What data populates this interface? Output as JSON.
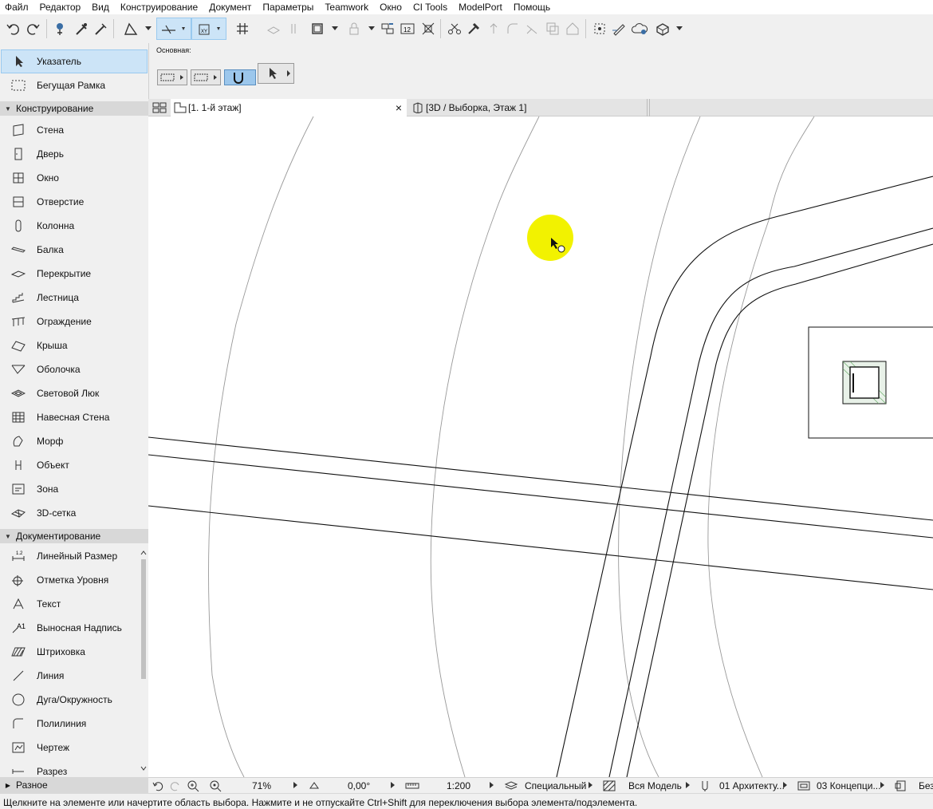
{
  "menu": [
    "Файл",
    "Редактор",
    "Вид",
    "Конструирование",
    "Документ",
    "Параметры",
    "Teamwork",
    "Окно",
    "CI Tools",
    "ModelPort",
    "Помощь"
  ],
  "toolbox": {
    "pointer": "Указатель",
    "marquee": "Бегущая Рамка",
    "group_design": "Конструирование",
    "design_tools": [
      {
        "label": "Стена",
        "icon": "wall-icon"
      },
      {
        "label": "Дверь",
        "icon": "door-icon"
      },
      {
        "label": "Окно",
        "icon": "window-icon"
      },
      {
        "label": "Отверстие",
        "icon": "opening-icon"
      },
      {
        "label": "Колонна",
        "icon": "column-icon"
      },
      {
        "label": "Балка",
        "icon": "beam-icon"
      },
      {
        "label": "Перекрытие",
        "icon": "slab-icon"
      },
      {
        "label": "Лестница",
        "icon": "stair-icon"
      },
      {
        "label": "Ограждение",
        "icon": "railing-icon"
      },
      {
        "label": "Крыша",
        "icon": "roof-icon"
      },
      {
        "label": "Оболочка",
        "icon": "shell-icon"
      },
      {
        "label": "Световой Люк",
        "icon": "skylight-icon"
      },
      {
        "label": "Навесная Стена",
        "icon": "curtain-wall-icon"
      },
      {
        "label": "Морф",
        "icon": "morph-icon"
      },
      {
        "label": "Объект",
        "icon": "object-icon"
      },
      {
        "label": "Зона",
        "icon": "zone-icon"
      },
      {
        "label": "3D-сетка",
        "icon": "mesh-icon"
      }
    ],
    "group_doc": "Документирование",
    "doc_tools": [
      {
        "label": "Линейный Размер",
        "icon": "dimension-icon"
      },
      {
        "label": "Отметка Уровня",
        "icon": "level-dimension-icon"
      },
      {
        "label": "Текст",
        "icon": "text-icon"
      },
      {
        "label": "Выносная Надпись",
        "icon": "label-icon"
      },
      {
        "label": "Штриховка",
        "icon": "fill-icon"
      },
      {
        "label": "Линия",
        "icon": "line-icon"
      },
      {
        "label": "Дуга/Окружность",
        "icon": "arc-icon"
      },
      {
        "label": "Полилиния",
        "icon": "polyline-icon"
      },
      {
        "label": "Чертеж",
        "icon": "drawing-icon"
      },
      {
        "label": "Разрез",
        "icon": "section-icon"
      }
    ],
    "group_misc": "Разное"
  },
  "infobox": {
    "caption": "Основная:"
  },
  "tabs": {
    "floorplan": "[1. 1-й этаж]",
    "threed": "[3D / Выборка, Этаж 1]",
    "close": "×"
  },
  "status": {
    "zoom": "71%",
    "angle": "0,00°",
    "scale": "1:200",
    "layer_combo": "Специальный",
    "model_view": "Вся Модель",
    "pen_set": "01 Архитекту...",
    "renovation": "03 Концепци...",
    "last": "Без"
  },
  "hint": "Щелкните на элементе или начертите область выбора. Нажмите и не отпускайте Ctrl+Shift для переключения выбора элемента/подэлемента."
}
